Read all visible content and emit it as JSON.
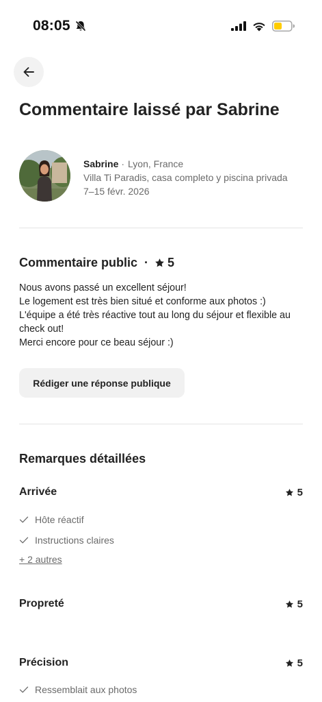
{
  "status_bar": {
    "time": "08:05",
    "icons": [
      "bell-slash-icon",
      "cellular-signal-icon",
      "wifi-icon",
      "battery-icon"
    ],
    "battery_color": "#ffcc00"
  },
  "header": {
    "back_icon": "arrow-left-icon",
    "title": "Commentaire laissé par Sabrine"
  },
  "guest": {
    "name": "Sabrine",
    "separator": "·",
    "city": "Lyon, France",
    "listing": "Villa Ti Paradis, casa completo y piscina privada",
    "dates": "7–15 févr. 2026"
  },
  "public_review": {
    "heading": "Commentaire public",
    "separator": "·",
    "rating": "5",
    "lines": [
      "Nous avons passé un excellent séjour!",
      "Le logement est très bien situé et conforme aux photos :)",
      "L'équipe a été très réactive tout au long du séjour et flexible au",
      "check out!",
      "Merci encore pour ce beau séjour :)"
    ],
    "reply_button": "Rédiger une réponse publique"
  },
  "detailed": {
    "heading": "Remarques détaillées",
    "categories": [
      {
        "name": "Arrivée",
        "rating": "5",
        "items": [
          "Hôte réactif",
          "Instructions claires"
        ],
        "more": "+ 2 autres"
      },
      {
        "name": "Propreté",
        "rating": "5"
      },
      {
        "name": "Précision",
        "rating": "5",
        "items": [
          "Ressemblait aux photos"
        ]
      }
    ]
  }
}
